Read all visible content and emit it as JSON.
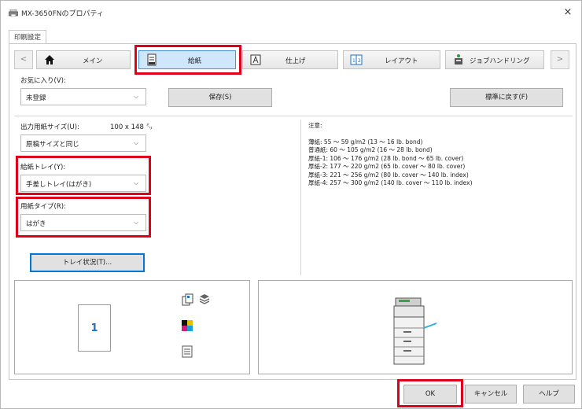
{
  "window": {
    "title": "MX-3650FNのプロパティ",
    "close": "×"
  },
  "tab": {
    "label": "印刷設定"
  },
  "nav": {
    "prev": "<",
    "next": ">",
    "items": [
      {
        "label": "メイン",
        "icon": "home-icon",
        "active": false
      },
      {
        "label": "給紙",
        "icon": "paper-tray-icon",
        "active": true
      },
      {
        "label": "仕上げ",
        "icon": "finishing-icon",
        "active": false
      },
      {
        "label": "レイアウト",
        "icon": "layout-icon",
        "active": false
      },
      {
        "label": "ジョブハンドリング",
        "icon": "job-handling-icon",
        "active": false
      }
    ]
  },
  "favorites": {
    "label": "お気に入り(V):",
    "value": "未登録",
    "save": "保存(S)",
    "restore": "標準に戻す(F)"
  },
  "output_size": {
    "label": "出力用紙サイズ(U):",
    "dim": "100 x 148 ㍉",
    "value": "原稿サイズと同じ"
  },
  "tray": {
    "label": "給紙トレイ(Y):",
    "value": "手差しトレイ(はがき)"
  },
  "paper_type": {
    "label": "用紙タイプ(R):",
    "value": "はがき"
  },
  "tray_status_button": "トレイ状況(T)...",
  "notes": {
    "title": "注意:",
    "lines": [
      "薄紙: 55 ～ 59 g/m2 (13 ～ 16 lb. bond)",
      "普通紙: 60 ～ 105 g/m2 (16 ～ 28 lb. bond)",
      "厚紙-1: 106 ～ 176 g/m2 (28 lb. bond ～ 65 lb. cover)",
      "厚紙-2: 177 ～ 220 g/m2 (65 lb. cover ～ 80 lb. cover)",
      "厚紙-3: 221 ～ 256 g/m2 (80 lb. cover ～ 140 lb. index)",
      "厚紙-4: 257 ～ 300 g/m2 (140 lb. cover ～ 110 lb. index)"
    ]
  },
  "preview": {
    "page_number": "1"
  },
  "footer": {
    "ok": "OK",
    "cancel": "キャンセル",
    "help": "ヘルプ"
  },
  "colors": {
    "highlight": "#e0001b",
    "active_tab": "#cfe6fb",
    "accent": "#0078d7"
  }
}
